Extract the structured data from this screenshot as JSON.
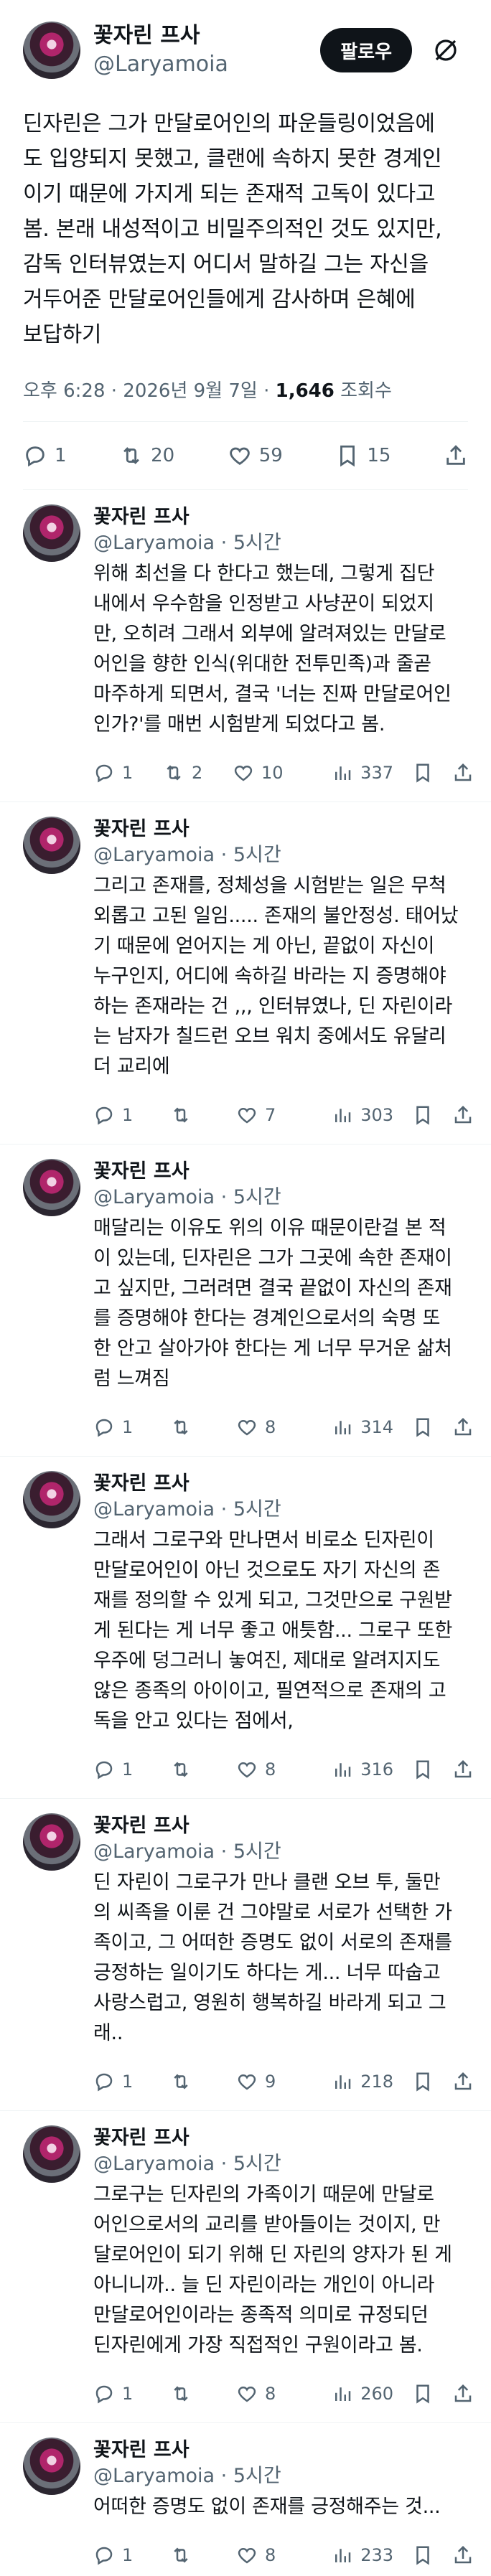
{
  "main": {
    "display_name": "꽃자린 프사",
    "handle": "@Laryamoia",
    "follow_label": "팔로우",
    "text": "딘자린은 그가 만달로어인의 파운들링이었음에\n도 입양되지 못했고, 클랜에 속하지 못한 경계인\n이기 때문에 가지게 되는 존재적 고독이 있다고\n봄. 본래 내성적이고 비밀주의적인 것도 있지만,\n감독 인터뷰였는지 어디서 말하길 그는 자신을\n거두어준 만달로어인들에게 감사하며 은혜에\n보답하기",
    "time": "오후 6:28 · 2026년 9월 7일 · ",
    "views": "1,646",
    "views_label": " 조회수",
    "stats": {
      "replies": "1",
      "retweets": "20",
      "likes": "59",
      "bookmarks": "15"
    }
  },
  "replies": [
    {
      "display_name": "꽃자린 프사",
      "handle": "@Laryamoia · 5시간",
      "text": "위해 최선을 다 한다고 했는데, 그렇게 집단\n내에서 우수함을 인정받고 사냥꾼이 되었지\n만, 오히려 그래서 외부에 알려져있는 만달로\n어인을 향한 인식(위대한 전투민족)과 줄곧\n마주하게 되면서, 결국 '너는 진짜 만달로어인\n인가?'를 매번 시험받게 되었다고 봄.",
      "replies": "1",
      "retweets": "2",
      "likes": "10",
      "views": "337"
    },
    {
      "display_name": "꽃자린 프사",
      "handle": "@Laryamoia · 5시간",
      "text": "그리고 존재를, 정체성을 시험받는 일은 무척\n외롭고 고된 일임..... 존재의 불안정성. 태어났\n기 때문에 얻어지는 게 아닌, 끝없이 자신이\n누구인지, 어디에 속하길 바라는 지 증명해야\n하는 존재라는 건 ,,, 인터뷰였나, 딘 자린이라\n는 남자가 칠드런 오브 워치 중에서도 유달리\n더 교리에",
      "replies": "1",
      "retweets": "",
      "likes": "7",
      "views": "303"
    },
    {
      "display_name": "꽃자린 프사",
      "handle": "@Laryamoia · 5시간",
      "text": "매달리는 이유도 위의 이유 때문이란걸 본 적\n이 있는데, 딘자린은 그가 그곳에 속한 존재이\n고 싶지만, 그러려면 결국 끝없이 자신의 존재\n를 증명해야 한다는 경계인으로서의 숙명 또\n한 안고 살아가야 한다는 게 너무 무거운 삶처\n럼 느껴짐",
      "replies": "1",
      "retweets": "",
      "likes": "8",
      "views": "314"
    },
    {
      "display_name": "꽃자린 프사",
      "handle": "@Laryamoia · 5시간",
      "text": "그래서 그로구와 만나면서 비로소 딘자린이\n만달로어인이 아닌 것으로도 자기 자신의 존\n재를 정의할 수 있게 되고, 그것만으로 구원받\n게 된다는 게 너무 좋고 애틋함... 그로구 또한\n우주에 덩그러니 놓여진, 제대로 알려지지도\n않은 종족의 아이이고, 필연적으로 존재의 고\n독을 안고 있다는 점에서,",
      "replies": "1",
      "retweets": "",
      "likes": "8",
      "views": "316"
    },
    {
      "display_name": "꽃자린 프사",
      "handle": "@Laryamoia · 5시간",
      "text": "딘 자린이 그로구가 만나 클랜 오브 투, 둘만\n의 씨족을 이룬 건 그야말로 서로가 선택한 가\n족이고, 그 어떠한 증명도 없이 서로의 존재를\n긍정하는 일이기도 하다는 게... 너무 따숩고\n사랑스럽고, 영원히 행복하길 바라게 되고 그\n래..",
      "replies": "1",
      "retweets": "",
      "likes": "9",
      "views": "218"
    },
    {
      "display_name": "꽃자린 프사",
      "handle": "@Laryamoia · 5시간",
      "text": "그로구는 딘자린의 가족이기 때문에 만달로\n어인으로서의 교리를 받아들이는 것이지, 만\n달로어인이 되기 위해 딘 자린의 양자가 된 게\n아니니까.. 늘 딘 자린이라는 개인이 아니라\n만달로어인이라는 종족적 의미로 규정되던\n딘자린에게 가장 직접적인 구원이라고 봄.",
      "replies": "1",
      "retweets": "",
      "likes": "8",
      "views": "260"
    },
    {
      "display_name": "꽃자린 프사",
      "handle": "@Laryamoia · 5시간",
      "text": "어떠한 증명도 없이 존재를 긍정해주는 것...",
      "replies": "1",
      "retweets": "",
      "likes": "8",
      "views": "233"
    }
  ]
}
